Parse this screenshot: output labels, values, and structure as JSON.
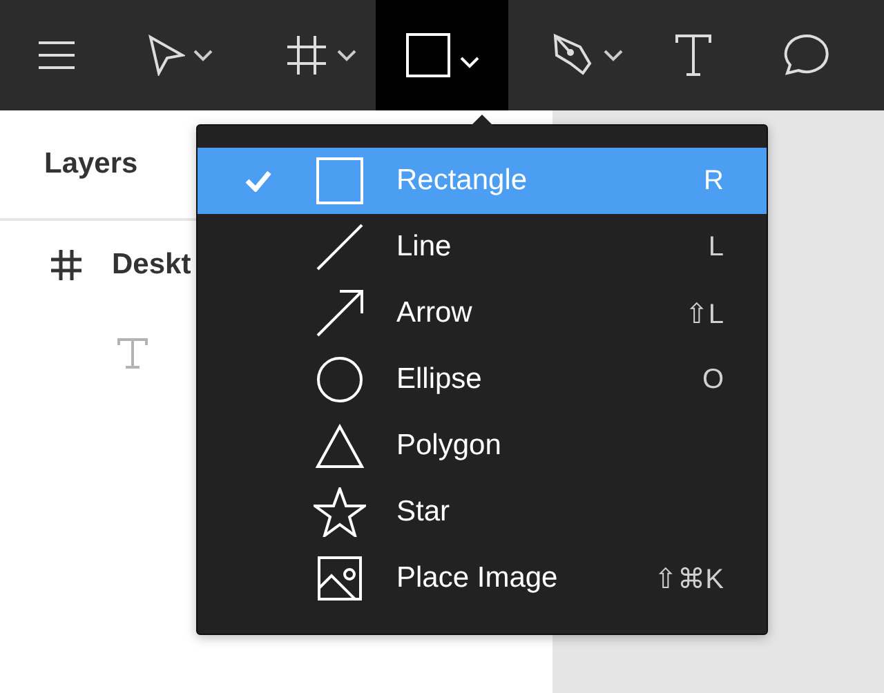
{
  "toolbar": {
    "tools": [
      {
        "kind": "menu",
        "selected": false,
        "has_dropdown": false
      },
      {
        "kind": "move",
        "selected": false,
        "has_dropdown": true
      },
      {
        "kind": "frame",
        "selected": false,
        "has_dropdown": true
      },
      {
        "kind": "shape",
        "selected": true,
        "has_dropdown": true
      },
      {
        "kind": "pen",
        "selected": false,
        "has_dropdown": true
      },
      {
        "kind": "text",
        "selected": false,
        "has_dropdown": false
      },
      {
        "kind": "comment",
        "selected": false,
        "has_dropdown": false
      }
    ]
  },
  "panel": {
    "tabs": [
      {
        "label": "Layers",
        "selected": true
      }
    ],
    "layers": [
      {
        "kind": "frame",
        "name": "Deskt",
        "children": [
          {
            "kind": "text"
          }
        ]
      }
    ]
  },
  "shape_menu": {
    "items": [
      {
        "kind": "rectangle",
        "label": "Rectangle",
        "shortcut": "R",
        "selected": true
      },
      {
        "kind": "line",
        "label": "Line",
        "shortcut": "L",
        "selected": false
      },
      {
        "kind": "arrow",
        "label": "Arrow",
        "shortcut": "⇧L",
        "selected": false
      },
      {
        "kind": "ellipse",
        "label": "Ellipse",
        "shortcut": "O",
        "selected": false
      },
      {
        "kind": "polygon",
        "label": "Polygon",
        "selected": false
      },
      {
        "kind": "star",
        "label": "Star",
        "selected": false
      },
      {
        "kind": "image",
        "label": "Place Image",
        "shortcut": "⇧⌘K",
        "selected": false
      }
    ]
  }
}
